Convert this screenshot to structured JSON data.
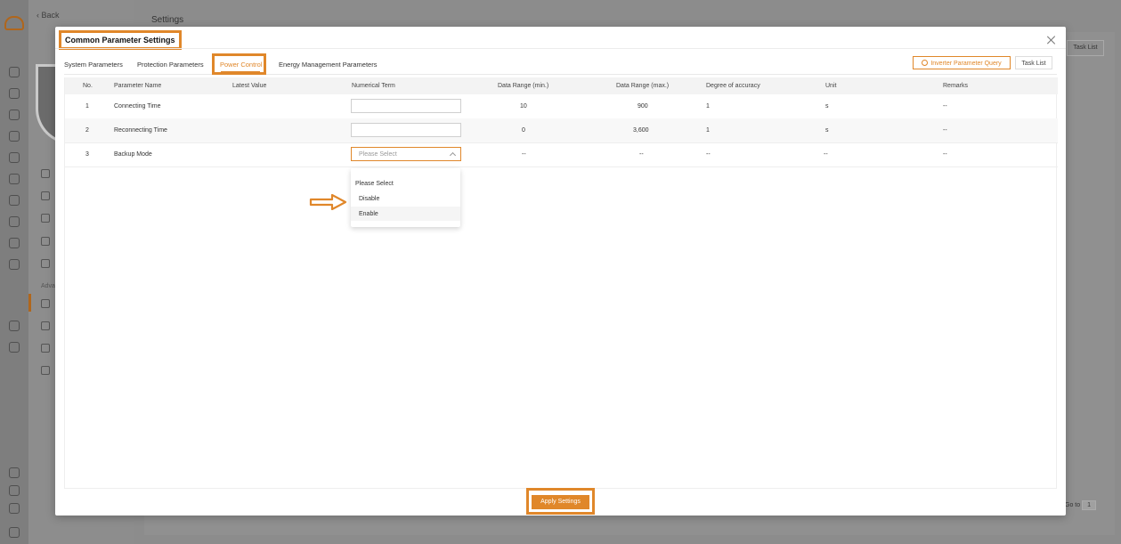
{
  "background": {
    "back_label": "Back",
    "page_title": "Settings",
    "task_list_label": "Task List",
    "nav_section_label": "Adva",
    "pager_text": "Go to",
    "pager_value": "1"
  },
  "modal": {
    "title": "Common Parameter Settings",
    "tabs": [
      {
        "label": "System Parameters"
      },
      {
        "label": "Protection Parameters"
      },
      {
        "label": "Power Control"
      },
      {
        "label": "Energy Management Parameters"
      }
    ],
    "active_tab": "Power Control",
    "query_button": "Inverter Parameter Query",
    "task_list_button": "Task List",
    "apply_button": "Apply Settings"
  },
  "table": {
    "headers": [
      "No.",
      "Parameter Name",
      "Latest Value",
      "Numerical Term",
      "Data Range (min.)",
      "Data Range (max.)",
      "Degree of accuracy",
      "Unit",
      "Remarks"
    ],
    "rows": [
      {
        "no": "1",
        "name": "Connecting Time",
        "latest": "",
        "term": "",
        "min": "10",
        "max": "900",
        "accuracy": "1",
        "unit": "s",
        "remarks": "--"
      },
      {
        "no": "2",
        "name": "Reconnecting Time",
        "latest": "",
        "term": "",
        "min": "0",
        "max": "3,600",
        "accuracy": "1",
        "unit": "s",
        "remarks": "--"
      },
      {
        "no": "3",
        "name": "Backup Mode",
        "latest": "",
        "term": "Please Select",
        "min": "--",
        "max": "--",
        "accuracy": "--",
        "unit": "--",
        "remarks": "--"
      }
    ]
  },
  "dropdown": {
    "options": [
      "Please Select",
      "Disable",
      "Enable"
    ],
    "highlighted": "Enable"
  },
  "colors": {
    "accent": "#e0872a",
    "header_bg": "#f3f3f3"
  }
}
